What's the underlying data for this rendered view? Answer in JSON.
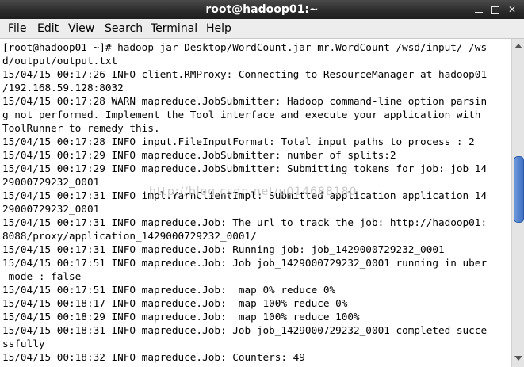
{
  "window": {
    "title": "root@hadoop01:~",
    "minimize_icon": "minimize-icon",
    "maximize_icon": "maximize-icon",
    "close_icon": "close-icon",
    "close_glyph": "✕"
  },
  "menu": {
    "file": "File",
    "edit": "Edit",
    "view": "View",
    "search": "Search",
    "terminal": "Terminal",
    "help": "Help"
  },
  "terminal": {
    "lines": [
      "[root@hadoop01 ~]# hadoop jar Desktop/WordCount.jar mr.WordCount /wsd/input/ /ws",
      "d/output/output.txt",
      "15/04/15 00:17:26 INFO client.RMProxy: Connecting to ResourceManager at hadoop01",
      "/192.168.59.128:8032",
      "15/04/15 00:17:28 WARN mapreduce.JobSubmitter: Hadoop command-line option parsin",
      "g not performed. Implement the Tool interface and execute your application with",
      "ToolRunner to remedy this.",
      "15/04/15 00:17:28 INFO input.FileInputFormat: Total input paths to process : 2",
      "15/04/15 00:17:29 INFO mapreduce.JobSubmitter: number of splits:2",
      "15/04/15 00:17:29 INFO mapreduce.JobSubmitter: Submitting tokens for job: job_14",
      "29000729232_0001",
      "15/04/15 00:17:31 INFO impl.YarnClientImpl: Submitted application application_14",
      "29000729232_0001",
      "15/04/15 00:17:31 INFO mapreduce.Job: The url to track the job: http://hadoop01:",
      "8088/proxy/application_1429000729232_0001/",
      "15/04/15 00:17:31 INFO mapreduce.Job: Running job: job_1429000729232_0001",
      "15/04/15 00:17:51 INFO mapreduce.Job: Job job_1429000729232_0001 running in uber",
      " mode : false",
      "15/04/15 00:17:51 INFO mapreduce.Job:  map 0% reduce 0%",
      "15/04/15 00:18:17 INFO mapreduce.Job:  map 100% reduce 0%",
      "15/04/15 00:18:29 INFO mapreduce.Job:  map 100% reduce 100%",
      "15/04/15 00:18:31 INFO mapreduce.Job: Job job_1429000729232_0001 completed succe",
      "ssfully",
      "15/04/15 00:18:32 INFO mapreduce.Job: Counters: 49"
    ],
    "watermark": "http://blog.csdn.net/u014688180"
  },
  "scrollbar": {
    "position_fraction": 0.44
  },
  "colors": {
    "titlebar": "#2a2a2a",
    "menubar": "#ededed",
    "scroll_thumb": "#4f7fcf"
  }
}
